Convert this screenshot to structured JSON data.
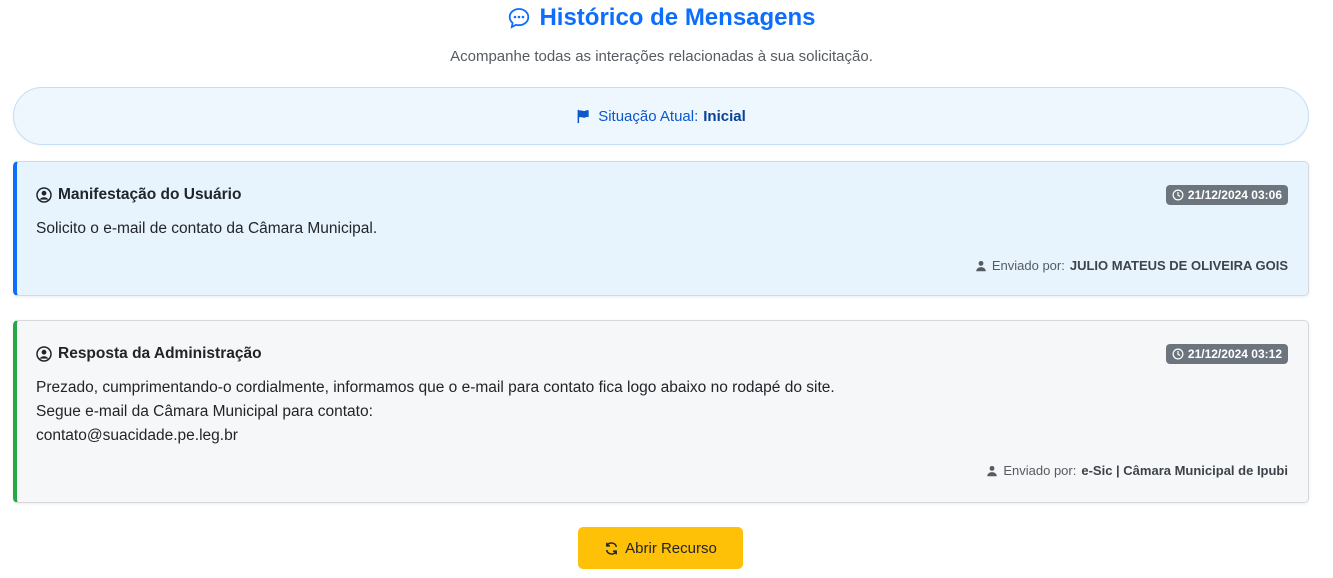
{
  "header": {
    "title": "Histórico de Mensagens",
    "subtitle": "Acompanhe todas as interações relacionadas à sua solicitação."
  },
  "status": {
    "label": "Situação Atual:",
    "value": "Inicial"
  },
  "messages": [
    {
      "title": "Manifestação do Usuário",
      "timestamp": "21/12/2024 03:06",
      "body_lines": [
        "Solicito o e-mail de contato da Câmara Municipal."
      ],
      "sent_by_label": "Enviado por:",
      "sender": "JULIO MATEUS DE OLIVEIRA GOIS"
    },
    {
      "title": "Resposta da Administração",
      "timestamp": "21/12/2024 03:12",
      "body_lines": [
        "Prezado, cumprimentando-o cordialmente, informamos que o e-mail para contato fica logo abaixo no rodapé do site.",
        "Segue e-mail da Câmara Municipal para contato:",
        "contato@suacidade.pe.leg.br"
      ],
      "sent_by_label": "Enviado por:",
      "sender": "e-Sic | Câmara Municipal de Ipubi"
    }
  ],
  "actions": {
    "appeal_label": "Abrir Recurso"
  },
  "icons": {
    "title": "chat-dots-icon",
    "status": "flag-icon",
    "message_title": "user-circle-icon",
    "timestamp": "clock-icon",
    "sender": "person-icon",
    "appeal": "refresh-icon"
  },
  "colors": {
    "primary": "#0d6efd",
    "user_accent": "#0d6efd",
    "admin_accent": "#28a745",
    "badge": "#6c757d",
    "button": "#ffc107"
  }
}
